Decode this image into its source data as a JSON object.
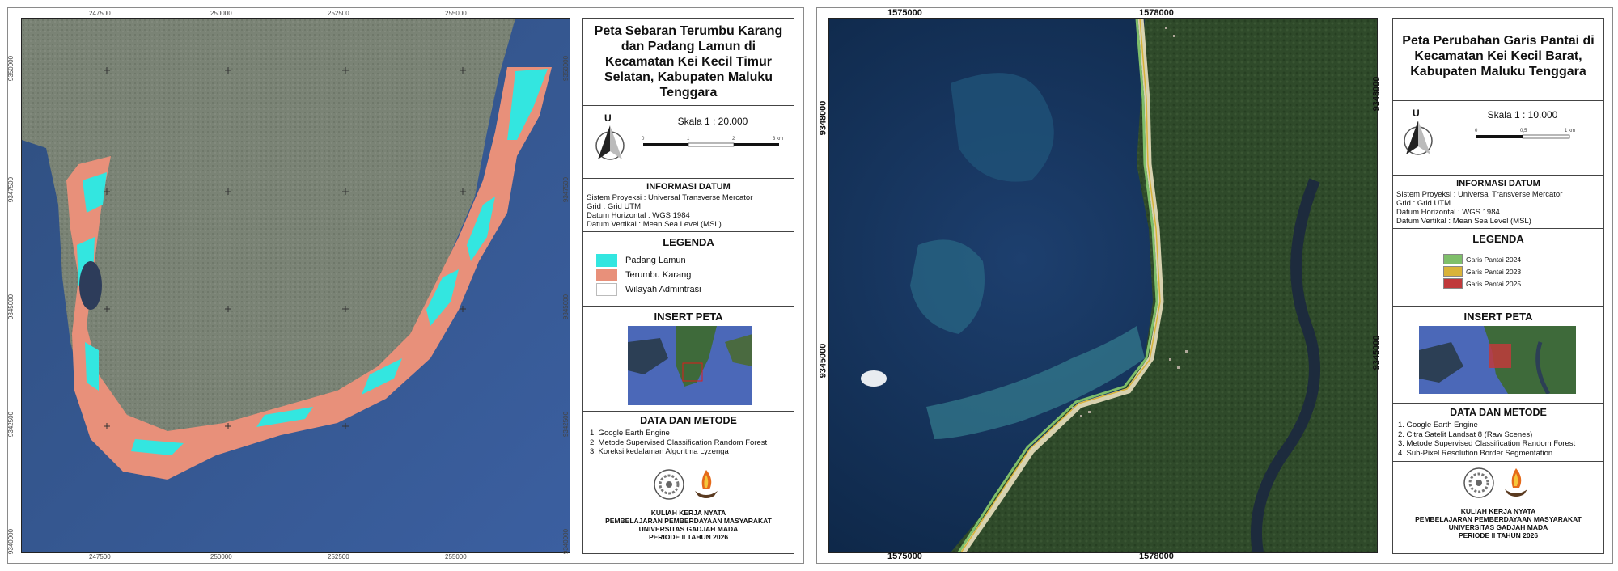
{
  "left": {
    "title": "Peta Sebaran Terumbu Karang dan Padang Lamun di Kecamatan Kei Kecil Timur Selatan, Kabupaten Maluku Tenggara",
    "north_letter": "U",
    "scale": "Skala 1 : 20.000",
    "scale_ticks": [
      "0",
      "1",
      "2",
      "3 km"
    ],
    "x_ticks": [
      "247500",
      "250000",
      "252500",
      "255000"
    ],
    "y_ticks": [
      "9350000",
      "9347500",
      "9345000",
      "9342500",
      "9340000"
    ],
    "datum_head": "INFORMASI DATUM",
    "datum_lines": [
      "Sistem Proyeksi : Universal Transverse Mercator",
      "Grid : Grid UTM",
      "Datum Horizontal : WGS 1984",
      "Datum Vertikal : Mean Sea Level (MSL)"
    ],
    "legend_head": "LEGENDA",
    "legend": [
      {
        "label": "Padang Lamun",
        "color": "#33e6e0"
      },
      {
        "label": "Terumbu Karang",
        "color": "#e8907a"
      },
      {
        "label": "Wilayah Admintrasi",
        "color": "#ffffff"
      }
    ],
    "insert_head": "INSERT PETA",
    "method_head": "DATA DAN METODE",
    "methods": [
      "1. Google Earth Engine",
      "2. Metode Supervised Classification Random Forest",
      "3. Koreksi kedalaman Algoritma Lyzenga"
    ],
    "footer": [
      "KULIAH KERJA NYATA",
      "PEMBELAJARAN PEMBERDAYAAN MASYARAKAT",
      "UNIVERSITAS GADJAH MADA",
      "PERIODE II TAHUN 2026"
    ]
  },
  "right": {
    "title": "Peta Perubahan Garis Pantai di Kecamatan Kei Kecil Barat, Kabupaten Maluku Tenggara",
    "north_letter": "U",
    "scale": "Skala 1 : 10.000",
    "scale_ticks": [
      "0",
      "0,5",
      "1 km"
    ],
    "x_ticks": [
      "1575000",
      "1578000"
    ],
    "y_ticks": [
      "9348000",
      "9345000"
    ],
    "datum_head": "INFORMASI DATUM",
    "datum_lines": [
      "Sistem Proyeksi : Universal Transverse Mercator",
      "Grid : Grid UTM",
      "Datum Horizontal : WGS 1984",
      "Datum Vertikal : Mean Sea Level (MSL)"
    ],
    "legend_head": "LEGENDA",
    "legend": [
      {
        "label": "Garis Pantai 2024",
        "color": "#7fbf6a"
      },
      {
        "label": "Garis Pantai 2023",
        "color": "#d9b33a"
      },
      {
        "label": "Garis Pantai 2025",
        "color": "#c0393b"
      }
    ],
    "insert_head": "INSERT PETA",
    "method_head": "DATA DAN METODE",
    "methods": [
      "1. Google Earth Engine",
      "2. Citra Satelit Landsat 8 (Raw Scenes)",
      "3. Metode Supervised Classification Random Forest",
      "4. Sub-Pixel Resolution Border Segmentation"
    ],
    "footer": [
      "KULIAH KERJA NYATA",
      "PEMBELAJARAN PEMBERDAYAAN MASYARAKAT",
      "UNIVERSITAS GADJAH MADA",
      "PERIODE II TAHUN 2026"
    ]
  }
}
